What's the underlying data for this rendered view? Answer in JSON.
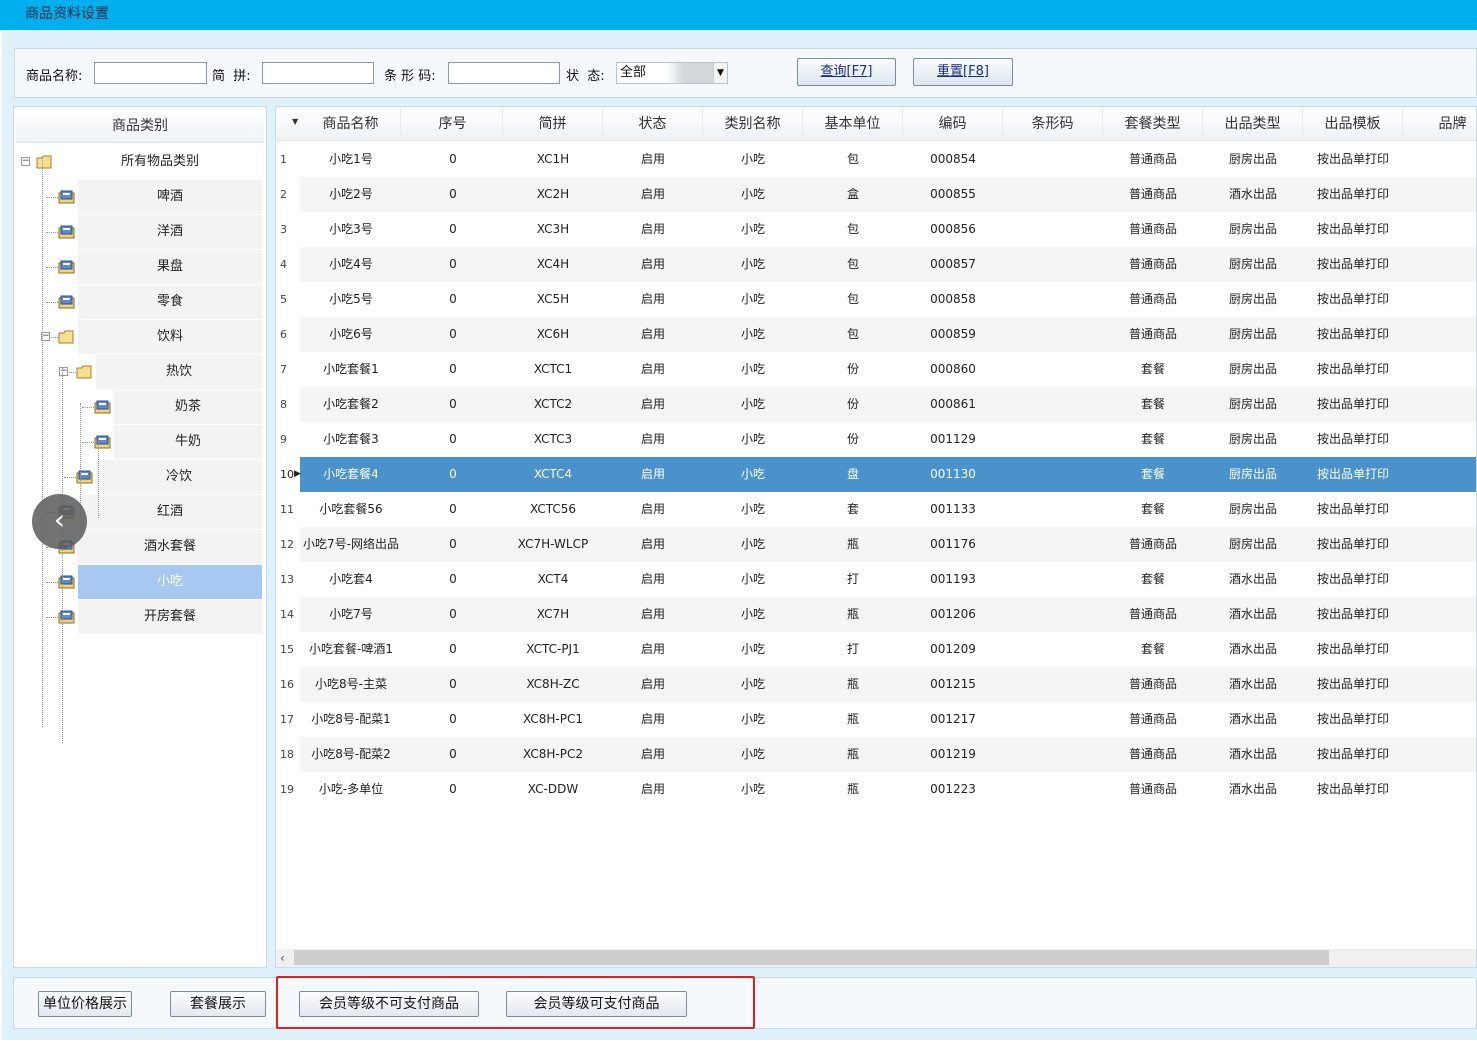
{
  "window": {
    "title": "商品资料设置"
  },
  "search": {
    "name_label": "商品名称:",
    "pinyin_label": "简  拼:",
    "barcode_label": "条 形 码:",
    "status_label": "状  态:",
    "status_value": "全部",
    "query_button": "查询[F7]",
    "reset_button": "重置[F8]"
  },
  "category_panel": {
    "header": "商品类别",
    "items": [
      {
        "label": "所有物品类别",
        "selected": false
      },
      {
        "label": "啤酒",
        "selected": false
      },
      {
        "label": "洋酒",
        "selected": false
      },
      {
        "label": "果盘",
        "selected": false
      },
      {
        "label": "零食",
        "selected": false
      },
      {
        "label": "饮料",
        "selected": false
      },
      {
        "label": "热饮",
        "selected": false
      },
      {
        "label": "奶茶",
        "selected": false
      },
      {
        "label": "牛奶",
        "selected": false
      },
      {
        "label": "冷饮",
        "selected": false
      },
      {
        "label": "红酒",
        "selected": false
      },
      {
        "label": "酒水套餐",
        "selected": false
      },
      {
        "label": "小吃",
        "selected": true
      },
      {
        "label": "开房套餐",
        "selected": false
      }
    ]
  },
  "grid": {
    "columns": [
      "商品名称",
      "序号",
      "简拼",
      "状态",
      "类别名称",
      "基本单位",
      "编码",
      "条形码",
      "套餐类型",
      "出品类型",
      "出品模板",
      "品牌"
    ],
    "selected_row": 10,
    "rows": [
      [
        "1",
        "小吃1号",
        "0",
        "XC1H",
        "启用",
        "小吃",
        "包",
        "000854",
        "",
        "普通商品",
        "厨房出品",
        "按出品单打印",
        ""
      ],
      [
        "2",
        "小吃2号",
        "0",
        "XC2H",
        "启用",
        "小吃",
        "盒",
        "000855",
        "",
        "普通商品",
        "酒水出品",
        "按出品单打印",
        ""
      ],
      [
        "3",
        "小吃3号",
        "0",
        "XC3H",
        "启用",
        "小吃",
        "包",
        "000856",
        "",
        "普通商品",
        "厨房出品",
        "按出品单打印",
        ""
      ],
      [
        "4",
        "小吃4号",
        "0",
        "XC4H",
        "启用",
        "小吃",
        "包",
        "000857",
        "",
        "普通商品",
        "厨房出品",
        "按出品单打印",
        ""
      ],
      [
        "5",
        "小吃5号",
        "0",
        "XC5H",
        "启用",
        "小吃",
        "包",
        "000858",
        "",
        "普通商品",
        "厨房出品",
        "按出品单打印",
        ""
      ],
      [
        "6",
        "小吃6号",
        "0",
        "XC6H",
        "启用",
        "小吃",
        "包",
        "000859",
        "",
        "普通商品",
        "厨房出品",
        "按出品单打印",
        ""
      ],
      [
        "7",
        "小吃套餐1",
        "0",
        "XCTC1",
        "启用",
        "小吃",
        "份",
        "000860",
        "",
        "套餐",
        "厨房出品",
        "按出品单打印",
        ""
      ],
      [
        "8",
        "小吃套餐2",
        "0",
        "XCTC2",
        "启用",
        "小吃",
        "份",
        "000861",
        "",
        "套餐",
        "厨房出品",
        "按出品单打印",
        ""
      ],
      [
        "9",
        "小吃套餐3",
        "0",
        "XCTC3",
        "启用",
        "小吃",
        "份",
        "001129",
        "",
        "套餐",
        "厨房出品",
        "按出品单打印",
        ""
      ],
      [
        "10",
        "小吃套餐4",
        "0",
        "XCTC4",
        "启用",
        "小吃",
        "盘",
        "001130",
        "",
        "套餐",
        "厨房出品",
        "按出品单打印",
        ""
      ],
      [
        "11",
        "小吃套餐56",
        "0",
        "XCTC56",
        "启用",
        "小吃",
        "套",
        "001133",
        "",
        "套餐",
        "厨房出品",
        "按出品单打印",
        ""
      ],
      [
        "12",
        "小吃7号-网络出品",
        "0",
        "XC7H-WLCP",
        "启用",
        "小吃",
        "瓶",
        "001176",
        "",
        "普通商品",
        "厨房出品",
        "按出品单打印",
        ""
      ],
      [
        "13",
        "小吃套4",
        "0",
        "XCT4",
        "启用",
        "小吃",
        "打",
        "001193",
        "",
        "套餐",
        "酒水出品",
        "按出品单打印",
        ""
      ],
      [
        "14",
        "小吃7号",
        "0",
        "XC7H",
        "启用",
        "小吃",
        "瓶",
        "001206",
        "",
        "普通商品",
        "酒水出品",
        "按出品单打印",
        ""
      ],
      [
        "15",
        "小吃套餐-啤酒1",
        "0",
        "XCTC-PJ1",
        "启用",
        "小吃",
        "打",
        "001209",
        "",
        "套餐",
        "酒水出品",
        "按出品单打印",
        ""
      ],
      [
        "16",
        "小吃8号-主菜",
        "0",
        "XC8H-ZC",
        "启用",
        "小吃",
        "瓶",
        "001215",
        "",
        "普通商品",
        "酒水出品",
        "按出品单打印",
        ""
      ],
      [
        "17",
        "小吃8号-配菜1",
        "0",
        "XC8H-PC1",
        "启用",
        "小吃",
        "瓶",
        "001217",
        "",
        "普通商品",
        "酒水出品",
        "按出品单打印",
        ""
      ],
      [
        "18",
        "小吃8号-配菜2",
        "0",
        "XC8H-PC2",
        "启用",
        "小吃",
        "瓶",
        "001219",
        "",
        "普通商品",
        "酒水出品",
        "按出品单打印",
        ""
      ],
      [
        "19",
        "小吃-多单位",
        "0",
        "XC-DDW",
        "启用",
        "小吃",
        "瓶",
        "001223",
        "",
        "普通商品",
        "酒水出品",
        "按出品单打印",
        ""
      ]
    ]
  },
  "bottom": {
    "unit_price_button": "单位价格展示",
    "package_button": "套餐展示",
    "member_nonpayable_button": "会员等级不可支付商品",
    "member_payable_button": "会员等级可支付商品"
  },
  "colors": {
    "titlebar": "#00b0ee",
    "background": "#dff1fb",
    "selected_row": "#4a92cc",
    "selected_tree": "#a7c8f0",
    "highlight_box": "#e02020"
  },
  "icons": {
    "nav": "chevron-left-icon",
    "category_leaf": "category-icon",
    "category_folder": "folder-icon"
  }
}
